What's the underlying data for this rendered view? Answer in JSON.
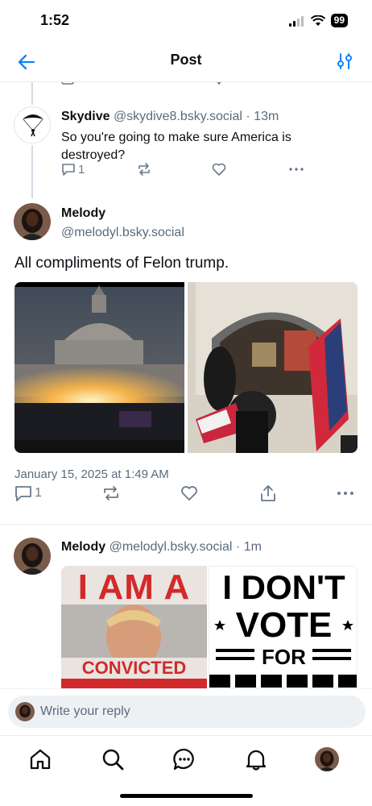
{
  "status_bar": {
    "time": "1:52",
    "battery": "99"
  },
  "header": {
    "title": "Post"
  },
  "parent_reply": {
    "name": "Skydive",
    "handle": "@skydive8.bsky.social",
    "time": "· 13m",
    "text": "So you're going to make sure America is destroyed?",
    "reply_count": "1"
  },
  "main_post": {
    "name": "Melody",
    "handle": "@melodyl.bsky.social",
    "text": "All compliments of Felon trump.",
    "timestamp": "January 15, 2025 at 1:49 AM",
    "reply_count": "1"
  },
  "reply_post": {
    "name": "Melody",
    "handle": "@melodyl.bsky.social",
    "time": "· 1m",
    "image_left_text": [
      "I AM A",
      "CONVICTED"
    ],
    "image_right_text": [
      "I DON'T",
      "VOTE",
      "FOR"
    ]
  },
  "reply_bar": {
    "placeholder": "Write your reply"
  },
  "icons": [
    "back-icon",
    "filter-icon",
    "reply-icon",
    "repost-icon",
    "like-icon",
    "more-icon",
    "share-icon",
    "home-icon",
    "search-icon",
    "chat-icon",
    "bell-icon"
  ],
  "colors": {
    "accent": "#1083fe",
    "muted": "#6a7a8c",
    "line": "#d4dbe2"
  }
}
